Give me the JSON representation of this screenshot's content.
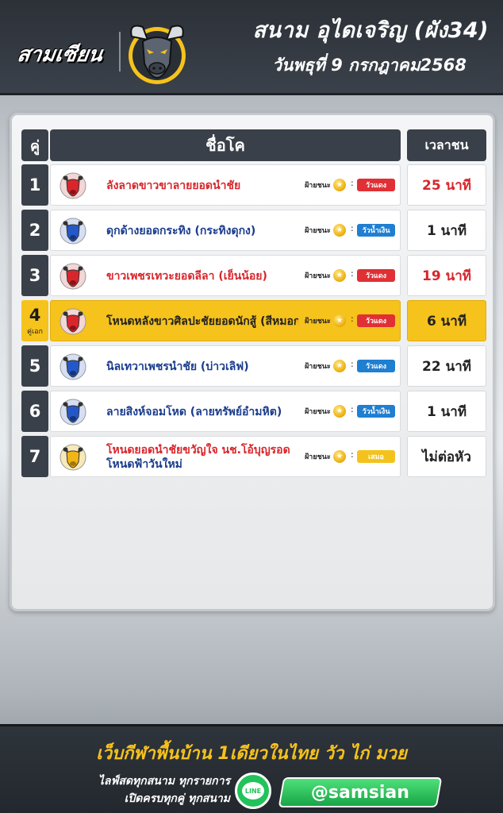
{
  "header": {
    "brand": "สามเซียน",
    "title": "สนาม อุไดเจริญ (ผัง34)",
    "date": "วันพธุที่ 9 กรกฎาคม2568"
  },
  "table": {
    "col_pair": "คู่",
    "col_name": "ชื่อโค",
    "col_time": "เวลาชน",
    "win_label": "ฝ้ายชนะ",
    "rows": [
      {
        "num": "1",
        "sub": "",
        "fighter1": "ลังลาดขาวขาลายยอดนำชัย",
        "fighter2": "",
        "tag": "วัวแดง",
        "time": "25 นาที"
      },
      {
        "num": "2",
        "sub": "",
        "fighter1": "ดุกด้างยอดกระทิง (กระทิงดุกง)",
        "fighter2": "",
        "tag": "วัวน้ำเงิน",
        "time": "1 นาที"
      },
      {
        "num": "3",
        "sub": "",
        "fighter1": "ขาวเพชรเทวะยอดลีลา (เย็นน้อย)",
        "fighter2": "",
        "tag": "วัวแดง",
        "time": "19 นาที"
      },
      {
        "num": "4",
        "sub": "คู่เอก",
        "fighter1": "โหนดหลังขาวศิลปะชัยยอดนักสู้ (สีหมอก)",
        "fighter2": "",
        "tag": "วัวแดง",
        "time": "6 นาที"
      },
      {
        "num": "5",
        "sub": "",
        "fighter1": "นิลเทวาเพชรนำชัย (บ่าวเลิฟ)",
        "fighter2": "",
        "tag": "วัวแดง",
        "time": "22 นาที"
      },
      {
        "num": "6",
        "sub": "",
        "fighter1": "ลายสิงห์จอมโหด (ลายทรัพย์อำมหิต)",
        "fighter2": "",
        "tag": "วัวน้ำเงิน",
        "time": "1 นาที"
      },
      {
        "num": "7",
        "sub": "",
        "fighter1": "โหนดยอดนำชัยขวัญใจ นช.โอ้บุญรอด",
        "fighter2": "โหนดฟ้าวันใหม่",
        "tag": "เสมอ",
        "time": "ไม่ต่อหัว"
      }
    ]
  },
  "footer": {
    "slogan": "เว็บกีฬาพื้นบ้าน 1เดียวในไทย วัว ไก่ มวย",
    "sub1": "ไลฟ์สดทุกสนาม ทุกรายการ",
    "sub2": "เปิดครบทุกคู่ ทุกสนาม",
    "line_label": "LINE",
    "handle": "@samsian"
  }
}
